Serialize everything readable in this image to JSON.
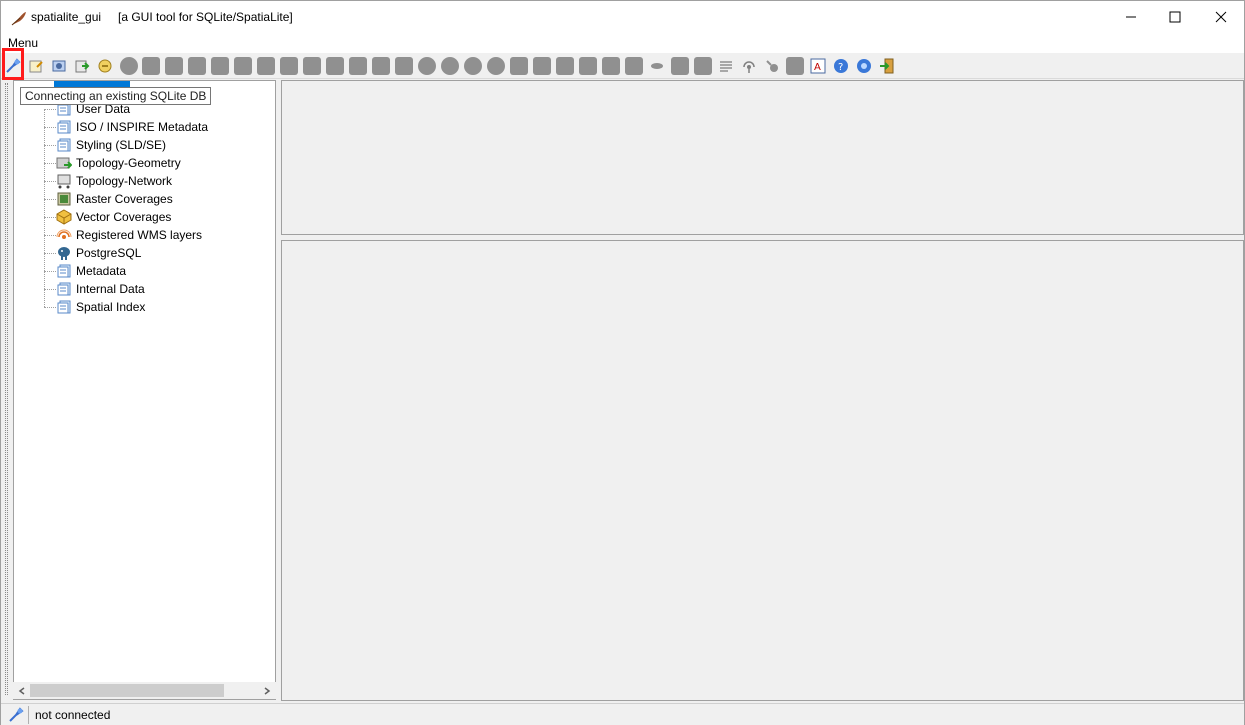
{
  "window": {
    "app_name": "spatialite_gui",
    "subtitle": "[a GUI tool for SQLite/SpatiaLite]"
  },
  "menubar": {
    "menu_label": "Menu"
  },
  "toolbar": {
    "tooltip": "Connecting an existing SQLite DB",
    "highlight_color": "#ff1a1a"
  },
  "tree": {
    "items": [
      {
        "label": "User Data",
        "icon": "table-icon"
      },
      {
        "label": "ISO / INSPIRE Metadata",
        "icon": "table-icon"
      },
      {
        "label": "Styling (SLD/SE)",
        "icon": "table-icon"
      },
      {
        "label": "Topology-Geometry",
        "icon": "topology-icon"
      },
      {
        "label": "Topology-Network",
        "icon": "network-icon"
      },
      {
        "label": "Raster Coverages",
        "icon": "raster-icon"
      },
      {
        "label": "Vector Coverages",
        "icon": "vector-icon"
      },
      {
        "label": "Registered WMS layers",
        "icon": "wms-icon"
      },
      {
        "label": "PostgreSQL",
        "icon": "postgres-icon"
      },
      {
        "label": "Metadata",
        "icon": "table-icon"
      },
      {
        "label": "Internal Data",
        "icon": "table-icon"
      },
      {
        "label": "Spatial Index",
        "icon": "table-icon"
      }
    ]
  },
  "status": {
    "text": "not connected"
  },
  "colors": {
    "selection": "#0078d7",
    "panel_bg": "#f0f0f0"
  }
}
